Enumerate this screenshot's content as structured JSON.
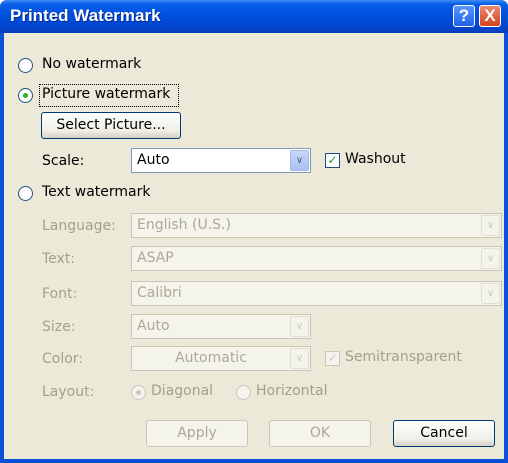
{
  "window": {
    "title": "Printed Watermark"
  },
  "titlebar_buttons": {
    "help": "?",
    "close": "X"
  },
  "options": {
    "no_watermark": "No watermark",
    "picture_watermark": "Picture watermark",
    "text_watermark": "Text watermark"
  },
  "picture": {
    "select_button": "Select Picture...",
    "scale_label": "Scale:",
    "scale_value": "Auto",
    "washout_label": "Washout",
    "washout_checked": true
  },
  "text": {
    "language_label": "Language:",
    "language_value": "English (U.S.)",
    "text_label": "Text:",
    "text_value": "ASAP",
    "font_label": "Font:",
    "font_value": "Calibri",
    "size_label": "Size:",
    "size_value": "Auto",
    "color_label": "Color:",
    "color_value": "Automatic",
    "semitransparent_label": "Semitransparent",
    "layout_label": "Layout:",
    "diagonal_label": "Diagonal",
    "horizontal_label": "Horizontal"
  },
  "buttons": {
    "apply": "Apply",
    "ok": "OK",
    "cancel": "Cancel"
  },
  "icons": {
    "dropdown": "chevron-down-icon",
    "check": "check-icon"
  },
  "glyphs": {
    "chevron": "∨",
    "check": "✓"
  }
}
